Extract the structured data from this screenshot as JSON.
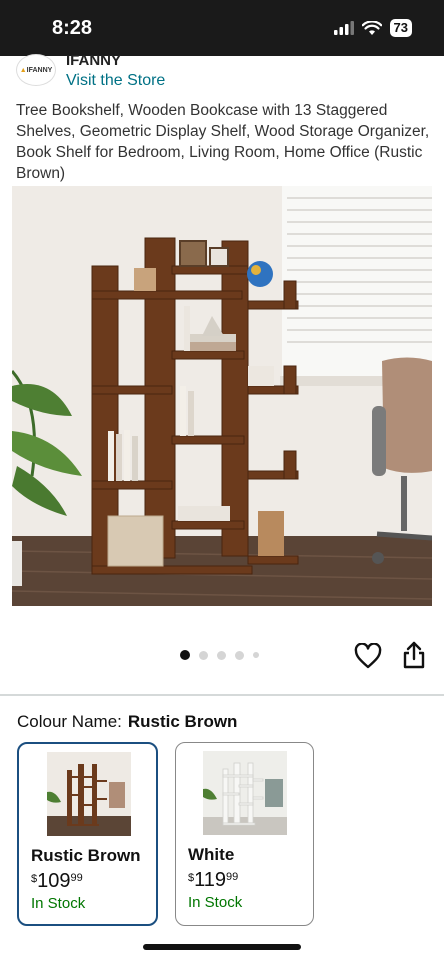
{
  "status_bar": {
    "time": "8:28",
    "battery": "73"
  },
  "store": {
    "logo_text": "IFANNY",
    "brand": "IFANNY",
    "visit_label": "Visit the Store"
  },
  "product": {
    "title": "Tree Bookshelf, Wooden Bookcase with 13 Staggered Shelves, Geometric Display Shelf, Wood Storage Organizer, Book Shelf for Bedroom, Living Room, Home Office (Rustic Brown)"
  },
  "gallery": {
    "image_count": 5,
    "active_index": 0
  },
  "colour": {
    "label": "Colour Name:",
    "selected": "Rustic Brown",
    "options": [
      {
        "name": "Rustic Brown",
        "currency": "$",
        "price_whole": "109",
        "price_fraction": "99",
        "stock": "In Stock"
      },
      {
        "name": "White",
        "currency": "$",
        "price_whole": "119",
        "price_fraction": "99",
        "stock": "In Stock"
      }
    ]
  },
  "colors": {
    "link": "#007185",
    "in_stock": "#007600",
    "selected_border": "#1b4f80",
    "wood": "#6b3a1c"
  }
}
